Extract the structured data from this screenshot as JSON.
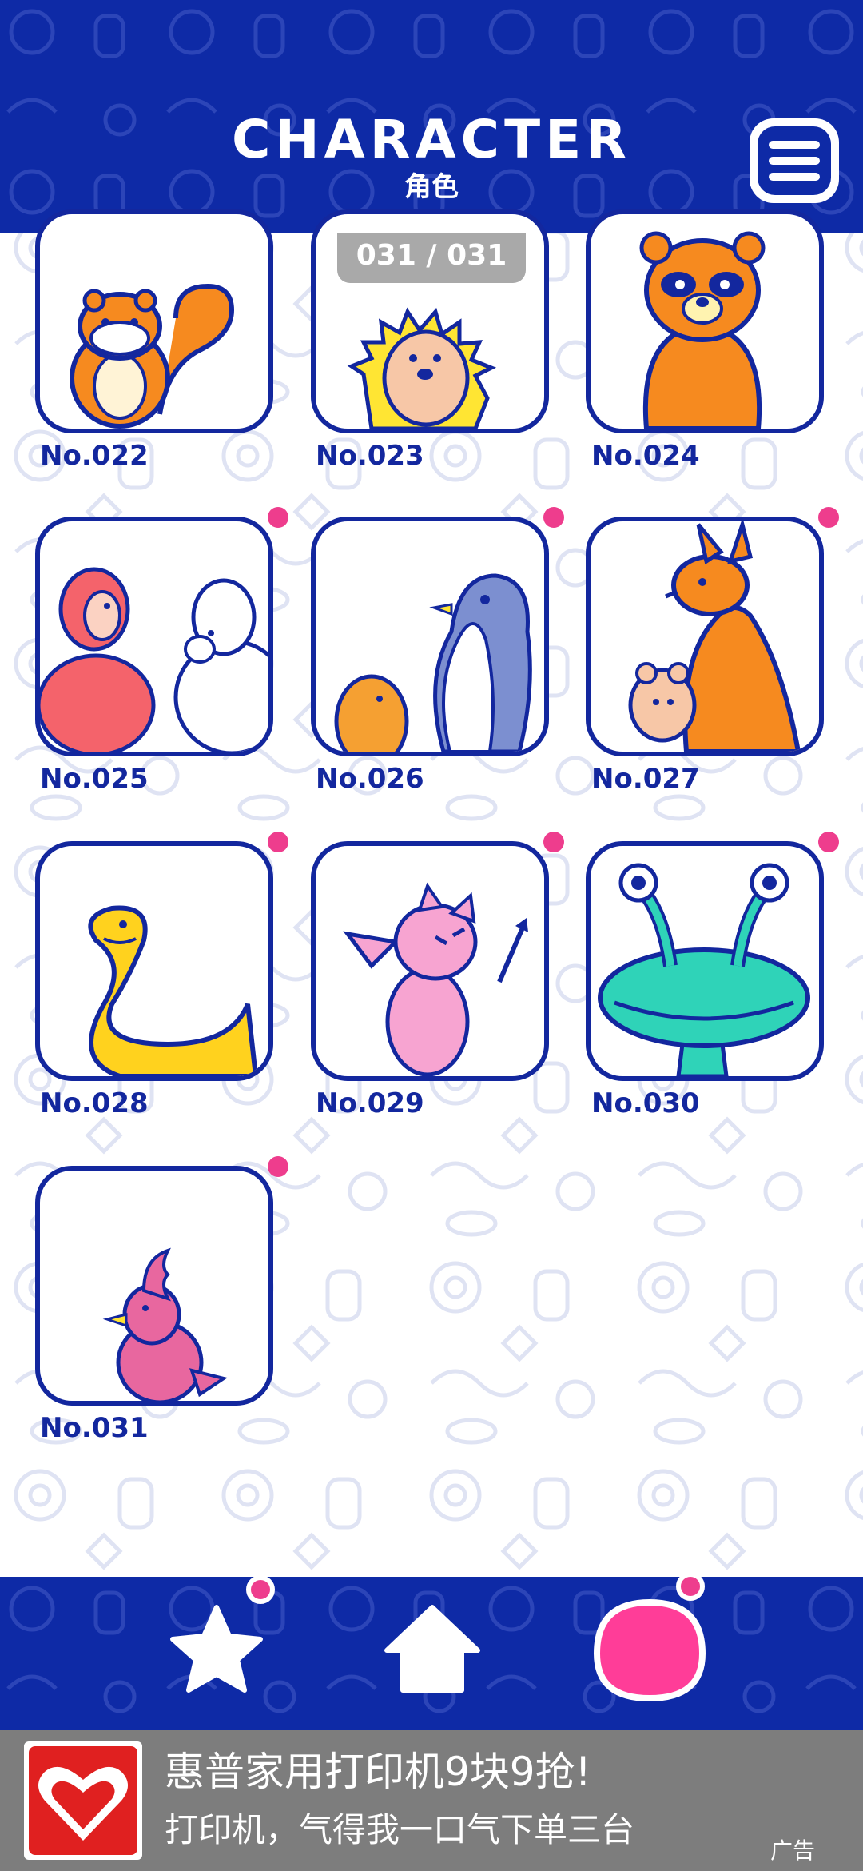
{
  "header": {
    "title": "CHARACTER",
    "subtitle": "角色",
    "menu_icon": "menu-icon"
  },
  "counter": "031 / 031",
  "characters": [
    {
      "number": "No.022",
      "animal": "squirrel",
      "new": false
    },
    {
      "number": "No.023",
      "animal": "hedgehog",
      "new": false
    },
    {
      "number": "No.024",
      "animal": "raccoon",
      "new": false
    },
    {
      "number": "No.025",
      "animal": "alpaca",
      "new": true
    },
    {
      "number": "No.026",
      "animal": "penguin",
      "new": true
    },
    {
      "number": "No.027",
      "animal": "kangaroo",
      "new": true
    },
    {
      "number": "No.028",
      "animal": "snake",
      "new": true
    },
    {
      "number": "No.029",
      "animal": "devil",
      "new": true
    },
    {
      "number": "No.030",
      "animal": "alien-mushroom",
      "new": true
    },
    {
      "number": "No.031",
      "animal": "cockatoo",
      "new": true
    }
  ],
  "bottom_nav": [
    {
      "icon": "star-icon",
      "badge": true
    },
    {
      "icon": "home-icon",
      "badge": false
    },
    {
      "icon": "character-blob-icon",
      "badge": true
    }
  ],
  "ad": {
    "title": "惠普家用打印机9块9抢!",
    "description": "打印机，气得我一口气下单三台",
    "badge": "广告",
    "logo_icon": "pinduoduo-logo-icon"
  },
  "colors": {
    "navy": "#0e2aa6",
    "outline": "#13279e",
    "badge_pink": "#ee3d8d",
    "ad_gray": "#7d7d7d"
  }
}
